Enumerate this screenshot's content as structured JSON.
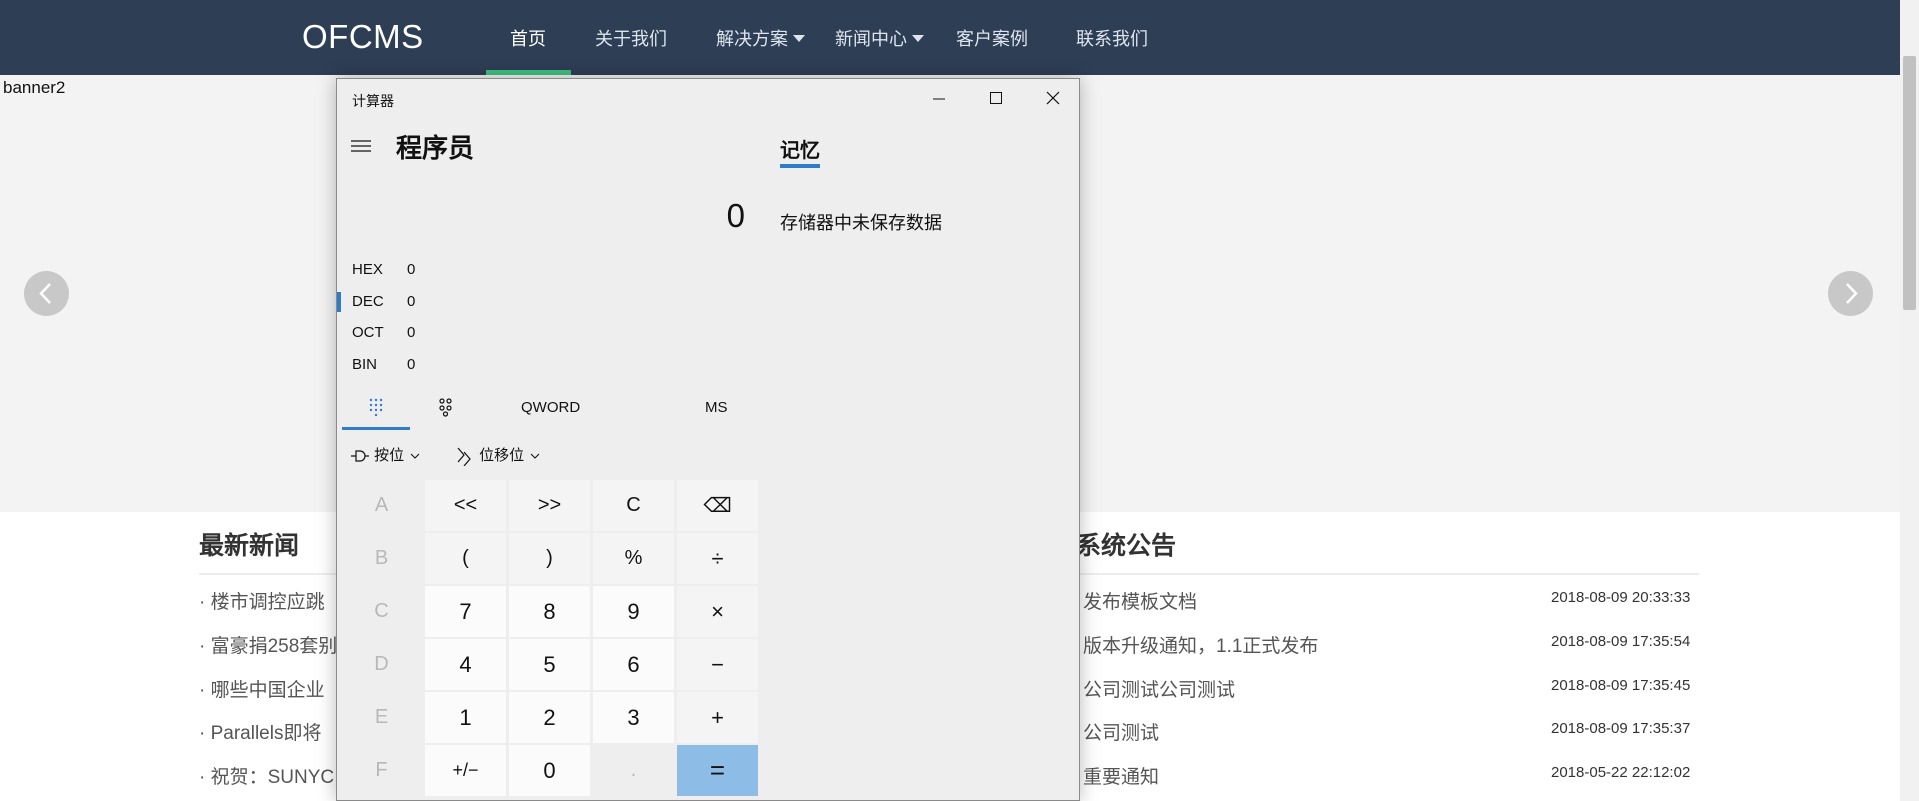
{
  "site": {
    "logo": "OFCMS",
    "nav": [
      {
        "label": "首页",
        "active": true,
        "dropdown": false
      },
      {
        "label": "关于我们",
        "active": false,
        "dropdown": false
      },
      {
        "label": "解决方案",
        "active": false,
        "dropdown": true
      },
      {
        "label": "新闻中心",
        "active": false,
        "dropdown": true
      },
      {
        "label": "客户案例",
        "active": false,
        "dropdown": false
      },
      {
        "label": "联系我们",
        "active": false,
        "dropdown": false
      }
    ],
    "banner_text": "banner2",
    "news": {
      "title": "最新新闻",
      "items": [
        "· 楼市调控应跳",
        "· 富豪捐258套别",
        "· 哪些中国企业",
        "· Parallels即将",
        "· 祝贺：SUNYC"
      ]
    },
    "notices": {
      "title": "系统公告",
      "items": [
        {
          "title": "发布模板文档",
          "date": "2018-08-09 20:33:33"
        },
        {
          "title": "版本升级通知，1.1正式发布",
          "date": "2018-08-09 17:35:54"
        },
        {
          "title": "公司测试公司测试",
          "date": "2018-08-09 17:35:45"
        },
        {
          "title": "公司测试",
          "date": "2018-08-09 17:35:37"
        },
        {
          "title": "重要通知",
          "date": "2018-05-22 22:12:02"
        }
      ]
    }
  },
  "calculator": {
    "window_title": "计算器",
    "mode": "程序员",
    "display": "0",
    "bases": [
      {
        "label": "HEX",
        "value": "0"
      },
      {
        "label": "DEC",
        "value": "0"
      },
      {
        "label": "OCT",
        "value": "0"
      },
      {
        "label": "BIN",
        "value": "0"
      }
    ],
    "word_size": "QWORD",
    "memory_store": "MS",
    "bitwise_label": "按位",
    "bitshift_label": "位移位",
    "memory_title": "记忆",
    "memory_empty": "存储器中未保存数据",
    "keys": [
      [
        "A",
        "<<",
        ">>",
        "C",
        "⌫"
      ],
      [
        "B",
        "(",
        ")",
        "%",
        "÷"
      ],
      [
        "C",
        "7",
        "8",
        "9",
        "×"
      ],
      [
        "D",
        "4",
        "5",
        "6",
        "−"
      ],
      [
        "E",
        "1",
        "2",
        "3",
        "+"
      ],
      [
        "F",
        "+/−",
        "0",
        ".",
        "="
      ]
    ],
    "accent_color": "#2f7cc9",
    "equals_color": "#8dbde6"
  }
}
